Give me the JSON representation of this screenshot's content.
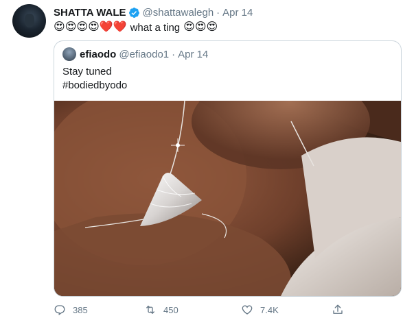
{
  "tweet": {
    "name": "SHATTA WALE",
    "handle": "@shattawalegh",
    "separator": "·",
    "date": "Apr 14",
    "emojis_before": [
      "😍",
      "😍",
      "😍",
      "😍",
      "❤️",
      "❤️"
    ],
    "caption": "what a ting",
    "emojis_after": [
      "😍",
      "😍",
      "😍"
    ]
  },
  "quote": {
    "name": "efiaodo",
    "handle": "@efiaodo1",
    "separator": "·",
    "date": "Apr 14",
    "line1": "Stay tuned",
    "line2": "#bodiedbyodo"
  },
  "actions": {
    "replies": "385",
    "retweets": "450",
    "likes": "7.4K"
  },
  "colors": {
    "text": "#14171a",
    "muted": "#657786",
    "verified": "#1da1f2",
    "border": "#ccd6dd"
  },
  "icons": [
    "verified-badge-icon",
    "reply-icon",
    "retweet-icon",
    "like-icon",
    "share-icon"
  ]
}
